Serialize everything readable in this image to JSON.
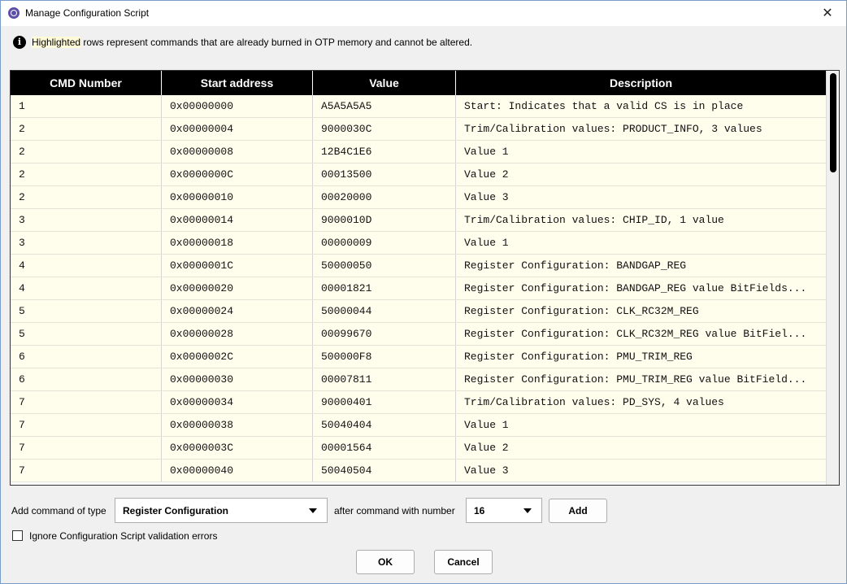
{
  "window": {
    "title": "Manage Configuration Script"
  },
  "info": {
    "highlight_word": "Highlighted",
    "message": " rows represent commands that are already burned in OTP memory and cannot be altered."
  },
  "table": {
    "columns": [
      "CMD Number",
      "Start address",
      "Value",
      "Description"
    ],
    "rows": [
      [
        "1",
        "0x00000000",
        "A5A5A5A5",
        "Start: Indicates that a valid CS is in place"
      ],
      [
        "2",
        "0x00000004",
        "9000030C",
        "Trim/Calibration values: PRODUCT_INFO, 3 values"
      ],
      [
        "2",
        "0x00000008",
        "12B4C1E6",
        "Value 1"
      ],
      [
        "2",
        "0x0000000C",
        "00013500",
        "Value 2"
      ],
      [
        "2",
        "0x00000010",
        "00020000",
        "Value 3"
      ],
      [
        "3",
        "0x00000014",
        "9000010D",
        "Trim/Calibration values: CHIP_ID, 1 value"
      ],
      [
        "3",
        "0x00000018",
        "00000009",
        "Value 1"
      ],
      [
        "4",
        "0x0000001C",
        "50000050",
        "Register Configuration: BANDGAP_REG"
      ],
      [
        "4",
        "0x00000020",
        "00001821",
        "Register Configuration: BANDGAP_REG value BitFields..."
      ],
      [
        "5",
        "0x00000024",
        "50000044",
        "Register Configuration: CLK_RC32M_REG"
      ],
      [
        "5",
        "0x00000028",
        "00099670",
        "Register Configuration: CLK_RC32M_REG value BitFiel..."
      ],
      [
        "6",
        "0x0000002C",
        "500000F8",
        "Register Configuration: PMU_TRIM_REG"
      ],
      [
        "6",
        "0x00000030",
        "00007811",
        "Register Configuration: PMU_TRIM_REG value BitField..."
      ],
      [
        "7",
        "0x00000034",
        "90000401",
        "Trim/Calibration values: PD_SYS, 4 values"
      ],
      [
        "7",
        "0x00000038",
        "50040404",
        "Value 1"
      ],
      [
        "7",
        "0x0000003C",
        "00001564",
        "Value 2"
      ],
      [
        "7",
        "0x00000040",
        "50040504",
        "Value 3"
      ]
    ]
  },
  "controls": {
    "add_label": "Add command of type",
    "type_value": "Register Configuration",
    "after_label": "after command with number",
    "number_value": "16",
    "add_button": "Add",
    "ignore_label": "Ignore Configuration Script validation errors",
    "ok_button": "OK",
    "cancel_button": "Cancel"
  },
  "colors": {
    "header_bg": "#000000",
    "row_bg": "#fffdec",
    "highlight": "#fffbd9"
  }
}
